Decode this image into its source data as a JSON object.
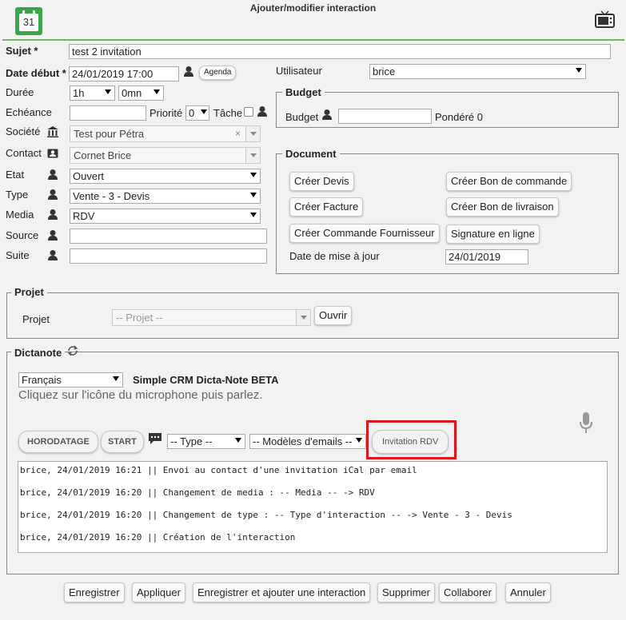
{
  "window": {
    "title": "Ajouter/modifier interaction",
    "calendar_day": "31"
  },
  "form": {
    "sujet": {
      "label": "Sujet *",
      "value": "test 2 invitation"
    },
    "date_debut": {
      "label": "Date début *",
      "value": "24/01/2019 17:00",
      "agenda_button": "Agenda"
    },
    "duree": {
      "label": "Durée",
      "hours": "1h",
      "minutes": "0mn"
    },
    "echeance": {
      "label": "Echéance",
      "value": ""
    },
    "priorite": {
      "label": "Priorité",
      "value": "0"
    },
    "tache": {
      "label": "Tâche",
      "checked": false
    },
    "societe": {
      "label": "Société",
      "value": "Test pour Pétra",
      "clear": "×"
    },
    "contact": {
      "label": "Contact",
      "value": "Cornet Brice"
    },
    "etat": {
      "label": "Etat",
      "value": "Ouvert"
    },
    "type": {
      "label": "Type",
      "value": "Vente - 3 - Devis"
    },
    "media": {
      "label": "Media",
      "value": "RDV"
    },
    "source": {
      "label": "Source",
      "value": ""
    },
    "suite": {
      "label": "Suite",
      "value": ""
    },
    "utilisateur": {
      "label": "Utilisateur",
      "value": "brice"
    }
  },
  "budget": {
    "legend": "Budget",
    "label": "Budget",
    "value": "",
    "pondere": "Pondéré 0"
  },
  "document": {
    "legend": "Document",
    "buttons": {
      "creer_devis": "Créer Devis",
      "creer_bon_commande": "Créer Bon de commande",
      "creer_facture": "Créer Facture",
      "creer_bon_livraison": "Créer Bon de livraison",
      "creer_commande_fournisseur": "Créer Commande Fournisseur",
      "signature": "Signature en ligne"
    },
    "date_maj_label": "Date de mise à jour",
    "date_maj_value": "24/01/2019"
  },
  "projet": {
    "legend": "Projet",
    "label": "Projet",
    "value": "-- Projet --",
    "open_button": "Ouvrir"
  },
  "dictanote": {
    "legend": "Dictanote",
    "language": "Français",
    "product": "Simple CRM Dicta-Note BETA",
    "hint": "Cliquez sur l'icône du microphone puis parlez.",
    "buttons": {
      "horodatage": "HORODATAGE",
      "start": "START",
      "invitation": "Invitation RDV"
    },
    "type_select": "-- Type --",
    "modeles_select": "-- Modèles d'emails --",
    "log": [
      "brice, 24/01/2019 16:21 || Envoi au contact d'une invitation iCal par email",
      "brice, 24/01/2019 16:20 || Changement de media : -- Media -- -> RDV",
      "brice, 24/01/2019 16:20 || Changement de type : -- Type d'interaction -- -> Vente - 3 - Devis",
      "brice, 24/01/2019 16:20 || Création de l'interaction"
    ]
  },
  "footer": {
    "enregistrer": "Enregistrer",
    "appliquer": "Appliquer",
    "enregistrer_ajouter": "Enregistrer et ajouter une interaction",
    "supprimer": "Supprimer",
    "collaborer": "Collaborer",
    "annuler": "Annuler"
  },
  "colors": {
    "accent_green": "#3aa54a",
    "highlight_red": "#e0141c"
  }
}
